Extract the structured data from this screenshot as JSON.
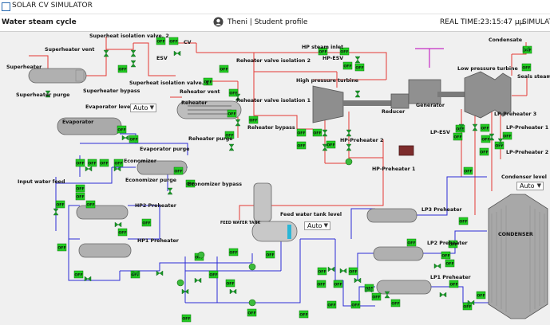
{
  "window": {
    "title": "SOLAR CV SIMULATOR"
  },
  "header": {
    "page_title": "Water steam cycle",
    "user_label": "Theni | Student profile",
    "real_time": "REAL TIME:23:15:47 μμ",
    "right_label": "SIMULATO"
  },
  "selects": {
    "evaporator_level": "Auto",
    "feed_water_tank_level": "Auto",
    "condenser_level": "Auto"
  },
  "labels": {
    "superheater": "Superheater",
    "superheater_vent": "Superheater vent",
    "superheat_iso2": "Superheat isolation valve. 2",
    "cv": "CV",
    "esv": "ESV",
    "superheater_purge": "Superheater purge",
    "superheater_bypass": "Superheater bypass",
    "superheat_iso1": "Superheat isolation valve. 1",
    "evaporator_level": "Evaporator level",
    "evaporator": "Evaporator",
    "evaporator_purge": "Evaporator purge",
    "reheater_valve_iso2": "Reheater valve isolation 2",
    "reheater_vent": "Reheater vent",
    "reheater": "Reheater",
    "reheater_valve_iso1": "Reheater valve isolation 1",
    "reheater_bypass": "Reheater bypass",
    "reheater_purge": "Reheater purge",
    "hp_steam_inlet": "HP steam inlet",
    "hp_esv": "HP-ESV",
    "high_pressure_turbine": "High pressure turbine",
    "reducer": "Reducer",
    "generator": "Generator",
    "low_pressure_turbine": "Low pressure turbine",
    "condensate": "Condensate",
    "seals_steam": "Seals steam",
    "lp_preheater3": "LP-Preheater 3",
    "lp_esv": "LP-ESV",
    "lp_preheater1": "LP-Preheater 1",
    "hp_preheater2": "HP-Preheater 2",
    "lp_preheater2": "LP-Preheater 2",
    "hp_preheater1": "HP-Preheater 1",
    "condenser_level": "Condenser level",
    "economizer": "Economizer",
    "economizer_purge": "Economizer purge",
    "economizer_bypass": "Economizer bypass",
    "input_water_feed": "Input water feed",
    "hp2_preheater": "HP2 Preheater",
    "hp1_preheater": "HP1 Preheater",
    "feed_water_tank": "FEED WATER TANK",
    "feed_water_tank_level": "Feed water tank level",
    "lp3_preheater": "LP3 Preheater",
    "lp2_preheater": "LP2 Preheater",
    "lp1_preheater": "LP1 Preheater",
    "condenser": "CONDENSER"
  },
  "off_label": "OFF",
  "colors": {
    "steam_line": "#e53935",
    "water_line": "#2b2bd6",
    "off_badge": "#22cc22",
    "valve": "#1a9a2a",
    "equipment": "#9e9e9e"
  }
}
